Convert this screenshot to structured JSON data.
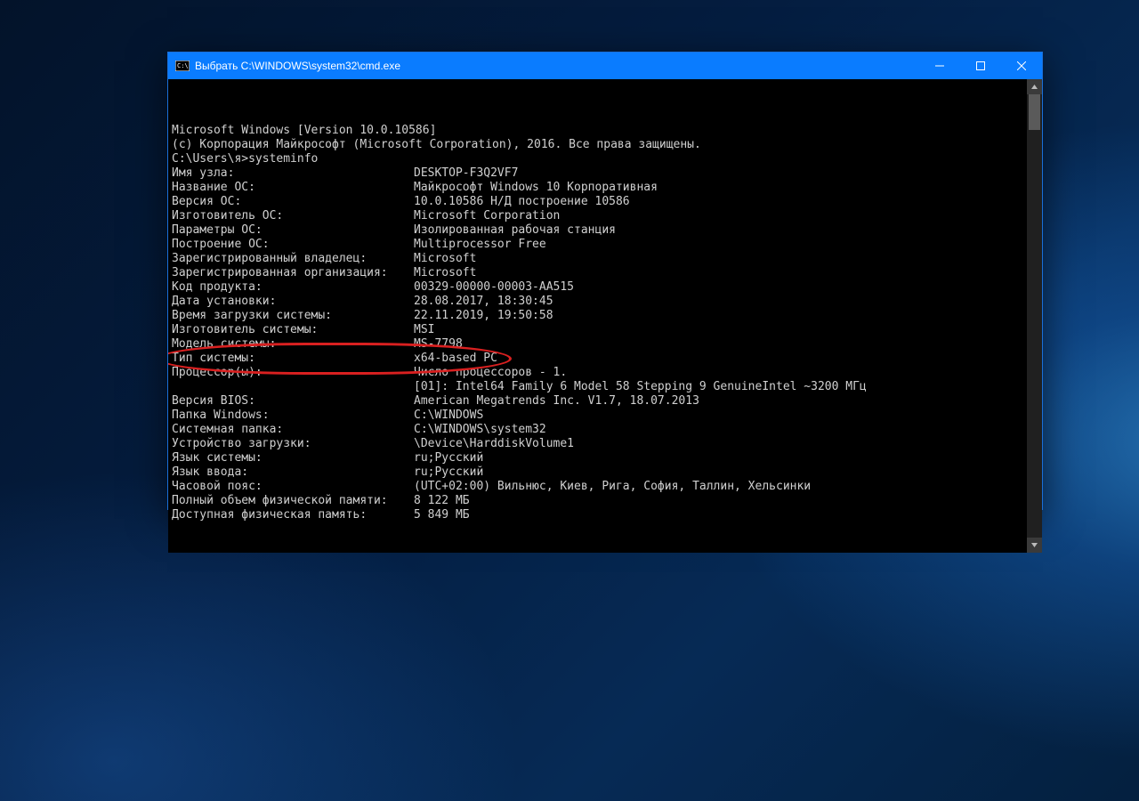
{
  "window": {
    "title": "Выбрать C:\\WINDOWS\\system32\\cmd.exe"
  },
  "terminal": {
    "header1": "Microsoft Windows [Version 10.0.10586]",
    "header2": "(c) Корпорация Майкрософт (Microsoft Corporation), 2016. Все права защищены.",
    "prompt": "C:\\Users\\я>systeminfo",
    "rows": [
      {
        "k": "Имя узла:",
        "v": "DESKTOP-F3Q2VF7"
      },
      {
        "k": "Название ОС:",
        "v": "Майкрософт Windows 10 Корпоративная"
      },
      {
        "k": "Версия ОС:",
        "v": "10.0.10586 Н/Д построение 10586"
      },
      {
        "k": "Изготовитель ОС:",
        "v": "Microsoft Corporation"
      },
      {
        "k": "Параметры ОС:",
        "v": "Изолированная рабочая станция"
      },
      {
        "k": "Построение ОС:",
        "v": "Multiprocessor Free"
      },
      {
        "k": "Зарегистрированный владелец:",
        "v": "Microsoft"
      },
      {
        "k": "Зарегистрированная организация:",
        "v": "Microsoft"
      },
      {
        "k": "Код продукта:",
        "v": "00329-00000-00003-AA515"
      },
      {
        "k": "Дата установки:",
        "v": "28.08.2017, 18:30:45"
      },
      {
        "k": "Время загрузки системы:",
        "v": "22.11.2019, 19:50:58"
      },
      {
        "k": "Изготовитель системы:",
        "v": "MSI"
      },
      {
        "k": "Модель системы:",
        "v": "MS-7798"
      },
      {
        "k": "Тип системы:",
        "v": "x64-based PC"
      },
      {
        "k": "Процессор(ы):",
        "v": "Число процессоров - 1."
      },
      {
        "k": "",
        "v": "[01]: Intel64 Family 6 Model 58 Stepping 9 GenuineIntel ~3200 МГц"
      },
      {
        "k": "Версия BIOS:",
        "v": "American Megatrends Inc. V1.7, 18.07.2013"
      },
      {
        "k": "Папка Windows:",
        "v": "C:\\WINDOWS"
      },
      {
        "k": "Системная папка:",
        "v": "C:\\WINDOWS\\system32"
      },
      {
        "k": "Устройство загрузки:",
        "v": "\\Device\\HarddiskVolume1"
      },
      {
        "k": "Язык системы:",
        "v": "ru;Русский"
      },
      {
        "k": "Язык ввода:",
        "v": "ru;Русский"
      },
      {
        "k": "Часовой пояс:",
        "v": "(UTC+02:00) Вильнюс, Киев, Рига, София, Таллин, Хельсинки"
      },
      {
        "k": "Полный объем физической памяти:",
        "v": "8 122 МБ"
      },
      {
        "k": "Доступная физическая память:",
        "v": "5 849 МБ"
      }
    ],
    "highlight_index": 13
  }
}
